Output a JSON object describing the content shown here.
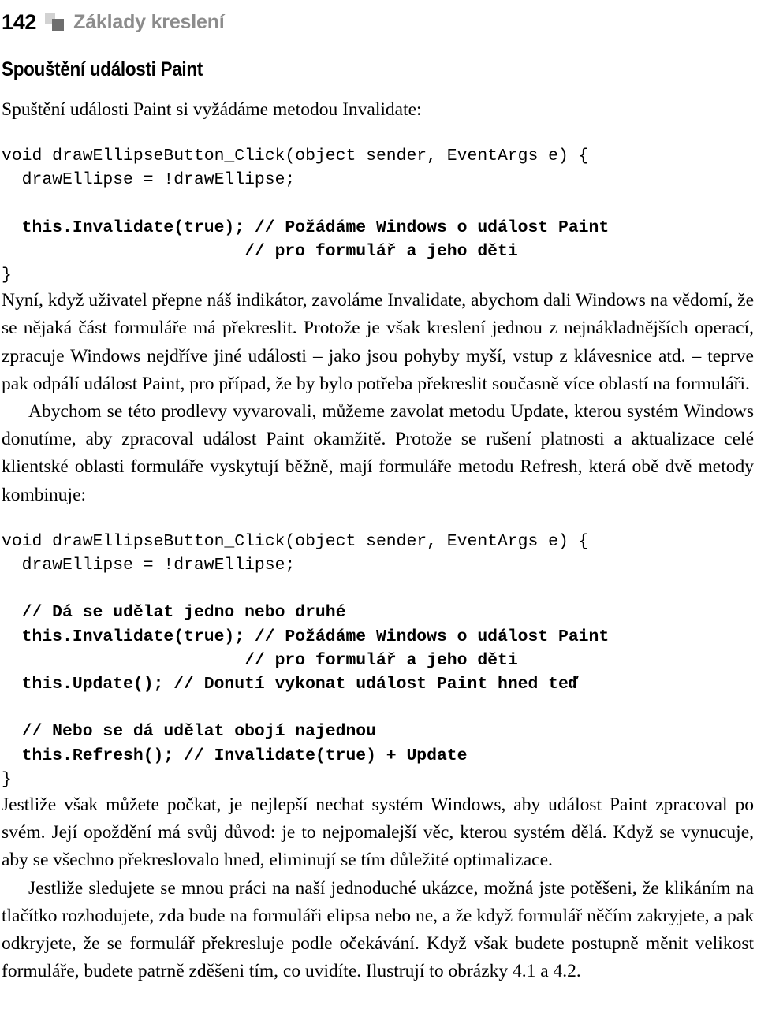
{
  "header": {
    "folio": "142",
    "chapter_title": "Základy kreslení",
    "icon": "two-squares-icon",
    "folio_color": "#000000",
    "title_color": "#8c8c8c",
    "icon_light_color": "#d2d2d2",
    "icon_dark_color": "#6e6e6e"
  },
  "section": {
    "heading": "Spouštění události Paint"
  },
  "paragraphs": {
    "intro": "Spuštění události Paint si vyžádáme metodou Invalidate:",
    "after_code_1": "Nyní, když uživatel přepne náš indikátor, zavoláme Invalidate, abychom dali Windows na vědomí, že se nějaká část formuláře má překreslit. Protože je však kreslení jednou z nejnákladnějších operací, zpracuje Windows nejdříve jiné události – jako jsou pohyby myší, vstup z klávesnice atd. – teprve pak odpálí událost Paint, pro případ, že by bylo potřeba překreslit současně více oblastí na formuláři.",
    "update_refresh": "Abychom se této prodlevy vyvarovali, můžeme zavolat metodu Update, kterou systém Windows donutíme, aby zpracoval událost Paint okamžitě. Protože se rušení platnosti a aktualizace celé klientské oblasti formuláře vyskytují běžně, mají formuláře metodu Refresh, která obě dvě metody kombinuje:",
    "after_code_2": "Jestliže však můžete počkat, je nejlepší nechat systém Windows, aby událost Paint zpracoval po svém. Její opoždění má svůj důvod: je to nejpomalejší věc, kterou systém dělá. Když se vynucuje, aby se všechno překreslovalo hned, eliminují se tím důležité optimalizace.",
    "closing": "Jestliže sledujete se mnou práci na naší jednoduché ukázce, možná jste potěšeni, že klikáním na tlačítko rozhodujete, zda bude na formuláři elipsa nebo ne, a že když formulář něčím zakryjete, a pak odkryjete, že se formulář překresluje podle očekávání. Když však budete postupně měnit velikost formuláře, budete patrně zděšeni tím, co uvidíte. Ilustrují to obrázky 4.1 a 4.2."
  },
  "code_blocks": {
    "first": [
      {
        "text": "void drawEllipseButton_Click(object sender, EventArgs e) {",
        "bold": false
      },
      {
        "text": "  drawEllipse = !drawEllipse;",
        "bold": false
      },
      {
        "text": "",
        "bold": false
      },
      {
        "text": "  this.Invalidate(true); // Požádáme Windows o událost Paint",
        "bold": true
      },
      {
        "text": "                        // pro formulář a jeho děti",
        "bold": true
      },
      {
        "text": "}",
        "bold": false
      }
    ],
    "second": [
      {
        "text": "void drawEllipseButton_Click(object sender, EventArgs e) {",
        "bold": false
      },
      {
        "text": "  drawEllipse = !drawEllipse;",
        "bold": false
      },
      {
        "text": "",
        "bold": false
      },
      {
        "text": "  // Dá se udělat jedno nebo druhé",
        "bold": true
      },
      {
        "text": "  this.Invalidate(true); // Požádáme Windows o událost Paint",
        "bold": true
      },
      {
        "text": "                        // pro formulář a jeho děti",
        "bold": true
      },
      {
        "text": "  this.Update(); // Donutí vykonat událost Paint hned teď",
        "bold": true
      },
      {
        "text": "",
        "bold": false
      },
      {
        "text": "  // Nebo se dá udělat obojí najednou",
        "bold": true
      },
      {
        "text": "  this.Refresh(); // Invalidate(true) + Update",
        "bold": true
      },
      {
        "text": "}",
        "bold": false
      }
    ]
  }
}
